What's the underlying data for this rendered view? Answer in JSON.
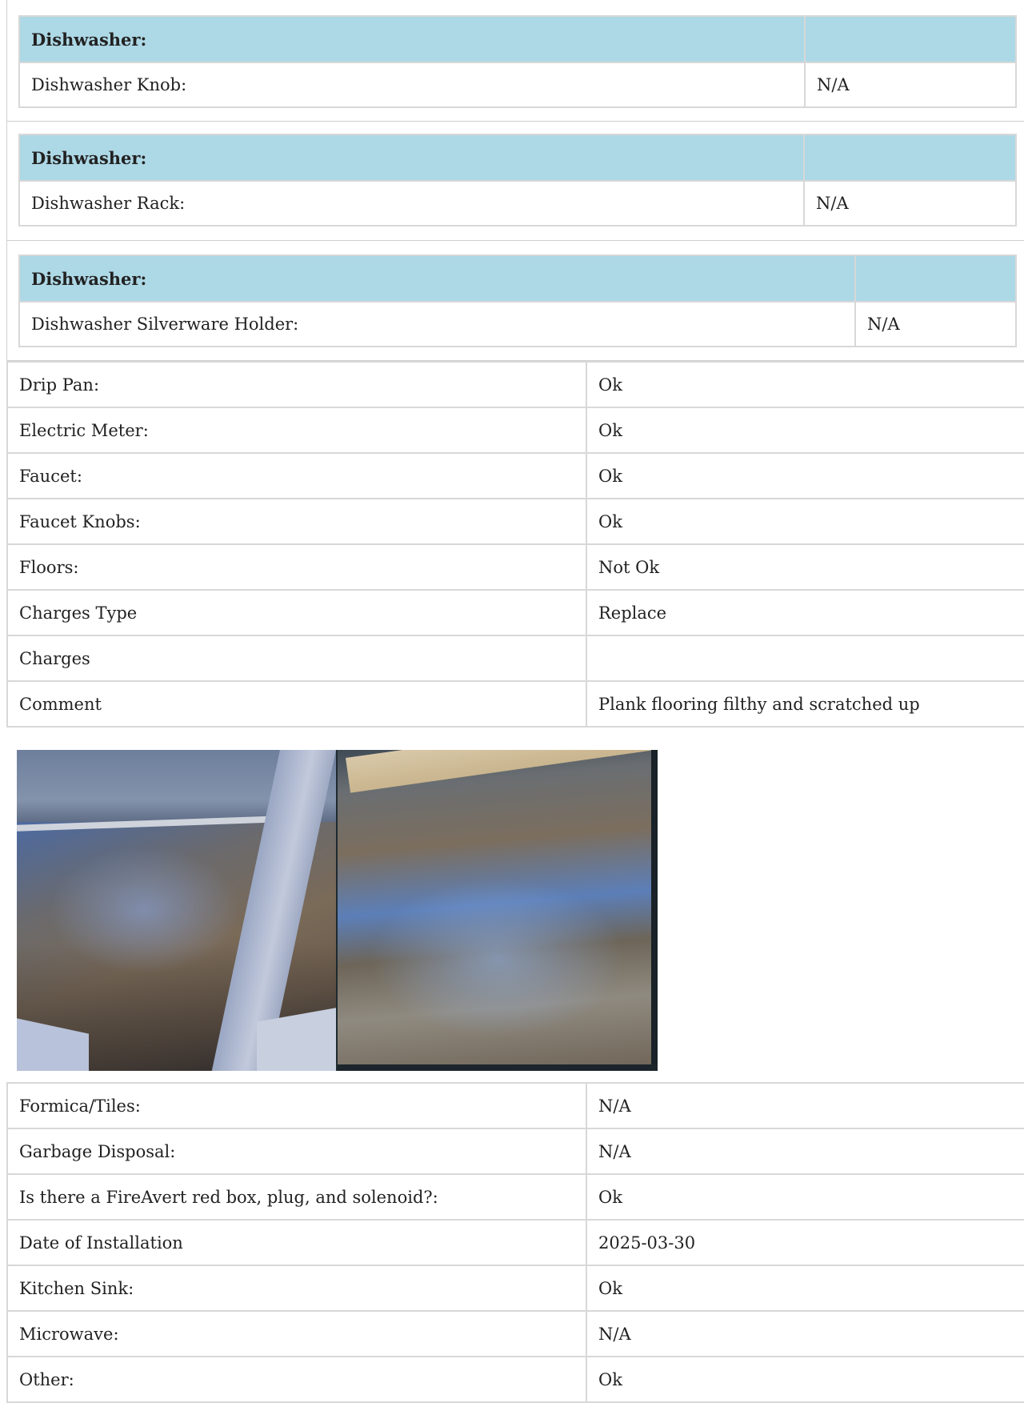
{
  "dishwasher_sections": [
    {
      "header": "Dishwasher:",
      "item_label": "Dishwasher Knob:",
      "item_value": "N/A"
    },
    {
      "header": "Dishwasher:",
      "item_label": "Dishwasher Rack:",
      "item_value": "N/A"
    },
    {
      "header": "Dishwasher:",
      "item_label": "Dishwasher Silverware Holder:",
      "item_value": "N/A"
    }
  ],
  "inspection_rows_a": [
    {
      "label": "Drip Pan:",
      "value": "Ok"
    },
    {
      "label": "Electric Meter:",
      "value": "Ok"
    },
    {
      "label": "Faucet:",
      "value": "Ok"
    },
    {
      "label": "Faucet Knobs:",
      "value": "Ok"
    },
    {
      "label": "Floors:",
      "value": "Not Ok"
    },
    {
      "label": "Charges Type",
      "value": "Replace"
    },
    {
      "label": "Charges",
      "value": ""
    },
    {
      "label": "Comment",
      "value": "Plank flooring filthy and scratched up"
    }
  ],
  "inspection_rows_b": [
    {
      "label": "Formica/Tiles:",
      "value": "N/A"
    },
    {
      "label": "Garbage Disposal:",
      "value": "N/A"
    },
    {
      "label": "Is there a FireAvert red box, plug, and solenoid?:",
      "value": "Ok"
    },
    {
      "label": "Date of Installation",
      "value": "2025-03-30"
    },
    {
      "label": "Kitchen Sink:",
      "value": "Ok"
    },
    {
      "label": "Microwave:",
      "value": "N/A"
    },
    {
      "label": "Other:",
      "value": "Ok"
    }
  ]
}
